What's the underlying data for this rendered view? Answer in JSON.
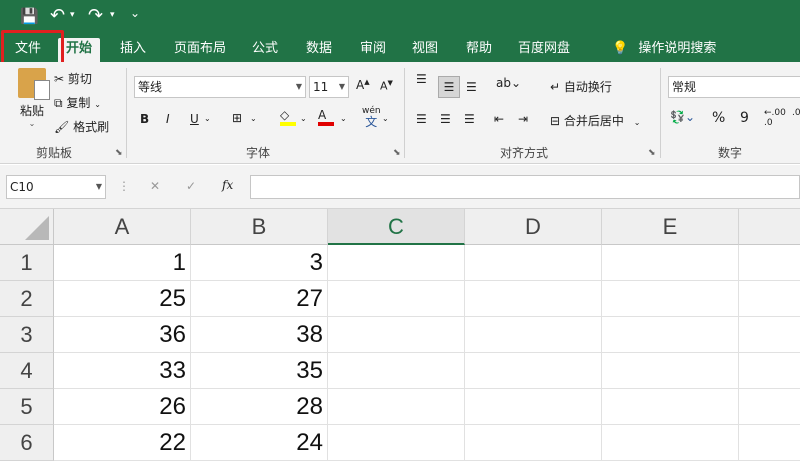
{
  "quick_access": {
    "save": "💾",
    "undo": "↶",
    "redo": "↷",
    "customize": "⌄"
  },
  "tabs": [
    "文件",
    "开始",
    "插入",
    "页面布局",
    "公式",
    "数据",
    "审阅",
    "视图",
    "帮助",
    "百度网盘"
  ],
  "tell_me": "操作说明搜索",
  "ribbon": {
    "paste": "粘贴",
    "cut": "剪切",
    "copy": "复制",
    "format_painter": "格式刷",
    "clipboard_group": "剪贴板",
    "font_name": "等线",
    "font_size": "11",
    "bold": "B",
    "italic": "I",
    "underline": "U",
    "phonetic": "wén",
    "phonetic_char": "文",
    "font_group": "字体",
    "wrap_text": "自动换行",
    "merge_center": "合并后居中",
    "align_group": "对齐方式",
    "number_format": "常规",
    "percent": "%",
    "comma": "9",
    "dec_inc": ".00",
    "number_group": "数字"
  },
  "formula_bar": {
    "name_box": "C10",
    "cancel": "✕",
    "enter": "✓",
    "fx": "fx",
    "formula": ""
  },
  "grid": {
    "columns": [
      "A",
      "B",
      "C",
      "D",
      "E"
    ],
    "selected_column": "C",
    "rows": [
      {
        "num": "1",
        "a": "1",
        "b": "3"
      },
      {
        "num": "2",
        "a": "25",
        "b": "27"
      },
      {
        "num": "3",
        "a": "36",
        "b": "38"
      },
      {
        "num": "4",
        "a": "33",
        "b": "35"
      },
      {
        "num": "5",
        "a": "26",
        "b": "28"
      },
      {
        "num": "6",
        "a": "22",
        "b": "24"
      }
    ]
  },
  "colors": {
    "excel_green": "#217346",
    "highlight_red": "#e02020"
  }
}
